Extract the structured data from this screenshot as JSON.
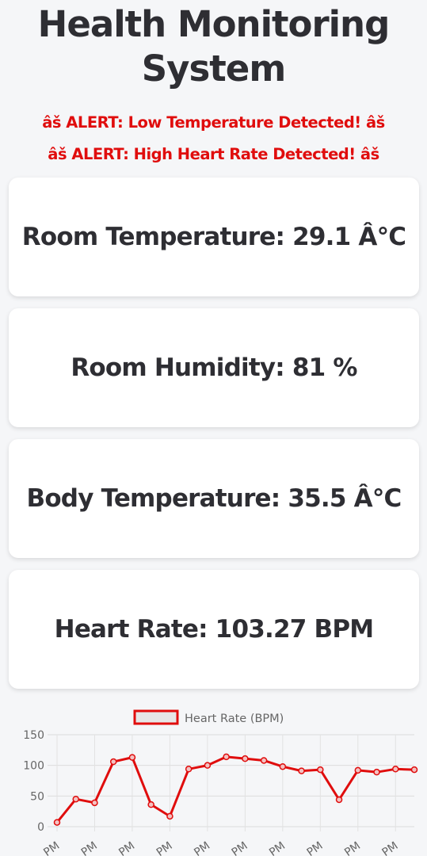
{
  "header": {
    "title_line1": "Health Monitoring",
    "title_line2": "System"
  },
  "alerts": [
    "âš  ALERT: Low Temperature Detected! âš",
    "âš  ALERT: High Heart Rate Detected! âš"
  ],
  "cards": {
    "room_temperature": "Room Temperature: 29.1 Â°C",
    "room_humidity": "Room Humidity: 81 %",
    "body_temperature": "Body Temperature: 35.5 Â°C",
    "heart_rate": "Heart Rate: 103.27 BPM"
  },
  "colors": {
    "alert": "#e00d0d",
    "series_line": "#e00d0d",
    "legend_fill": "#e6e6e6"
  },
  "chart_data": {
    "type": "line",
    "legend": "Heart Rate (BPM)",
    "legend_position": "top-center",
    "grid": true,
    "ylim": [
      0,
      150
    ],
    "y_ticks": [
      "0",
      "50",
      "100",
      "150"
    ],
    "x_tick_label": "PM",
    "series": [
      {
        "name": "Heart Rate (BPM)",
        "values": [
          7,
          45,
          39,
          106,
          113,
          36,
          17,
          94,
          100,
          114,
          111,
          108,
          98,
          91,
          93,
          44,
          92,
          89,
          94,
          93
        ]
      }
    ]
  }
}
